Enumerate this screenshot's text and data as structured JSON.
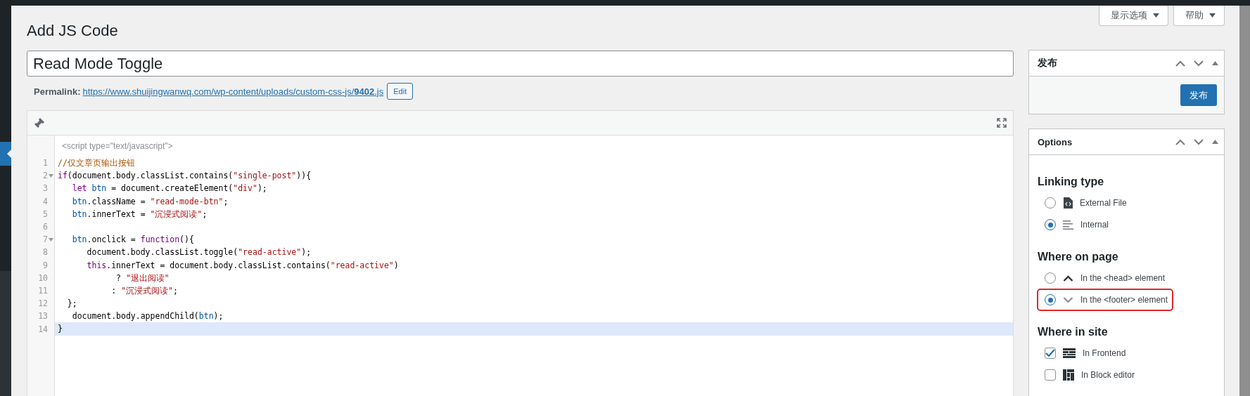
{
  "top_buttons": [
    {
      "label": "显示选项"
    },
    {
      "label": "帮助"
    }
  ],
  "page_title": "Add JS Code",
  "title_field": {
    "value": "Read Mode Toggle"
  },
  "permalink": {
    "label": "Permalink:",
    "url": "https://www.shuijingwanwq.com/wp-content/uploads/custom-css-js/**9402**.js",
    "edit_button": "Edit"
  },
  "editor": {
    "header_line": "<script type=\"text/javascript\">",
    "lines": [
      {
        "number": "1",
        "foldable": false,
        "active": false,
        "tokens": [
          {
            "kind": "comment",
            "text": "//仅文章页输出按钮"
          }
        ]
      },
      {
        "number": "2",
        "foldable": true,
        "active": false,
        "tokens": [
          {
            "kind": "keyword",
            "text": "if"
          },
          {
            "kind": "plain",
            "text": "(document.body.classList.contains("
          },
          {
            "kind": "string",
            "text": "\"single-post\""
          },
          {
            "kind": "plain",
            "text": ")){"
          }
        ]
      },
      {
        "number": "3",
        "foldable": false,
        "active": false,
        "tokens": [
          {
            "kind": "keyword",
            "text": "   let"
          },
          {
            "kind": "variable",
            "text": " btn"
          },
          {
            "kind": "plain",
            "text": " = document.createElement("
          },
          {
            "kind": "string",
            "text": "\"div\""
          },
          {
            "kind": "plain",
            "text": ");"
          }
        ]
      },
      {
        "number": "4",
        "foldable": false,
        "active": false,
        "tokens": [
          {
            "kind": "variable",
            "text": "   btn"
          },
          {
            "kind": "plain",
            "text": ".className = "
          },
          {
            "kind": "string",
            "text": "\"read-mode-btn\""
          },
          {
            "kind": "plain",
            "text": ";"
          }
        ]
      },
      {
        "number": "5",
        "foldable": false,
        "active": false,
        "tokens": [
          {
            "kind": "variable",
            "text": "   btn"
          },
          {
            "kind": "plain",
            "text": ".innerText = "
          },
          {
            "kind": "string",
            "text": "\"沉浸式阅读\""
          },
          {
            "kind": "plain",
            "text": ";"
          }
        ]
      },
      {
        "number": "6",
        "foldable": false,
        "active": false
      },
      {
        "number": "7",
        "foldable": true,
        "active": false,
        "tokens": [
          {
            "kind": "variable",
            "text": "   btn"
          },
          {
            "kind": "plain",
            "text": ".onclick = "
          },
          {
            "kind": "keyword",
            "text": "function"
          },
          {
            "kind": "plain",
            "text": "(){"
          }
        ]
      },
      {
        "number": "8",
        "foldable": false,
        "active": false,
        "tokens": [
          {
            "kind": "plain",
            "text": "      document.body.classList.toggle("
          },
          {
            "kind": "string",
            "text": "\"read-active\""
          },
          {
            "kind": "plain",
            "text": ");"
          }
        ]
      },
      {
        "number": "9",
        "foldable": false,
        "active": false,
        "tokens": [
          {
            "kind": "keyword",
            "text": "      this"
          },
          {
            "kind": "plain",
            "text": ".innerText = document.body.classList.contains("
          },
          {
            "kind": "string",
            "text": "\"read-active\""
          },
          {
            "kind": "plain",
            "text": ")"
          }
        ]
      },
      {
        "number": "10",
        "foldable": false,
        "active": false,
        "tokens": [
          {
            "kind": "plain",
            "text": "            ? "
          },
          {
            "kind": "string",
            "text": "\"退出阅读\""
          }
        ]
      },
      {
        "number": "11",
        "foldable": false,
        "active": false,
        "tokens": [
          {
            "kind": "plain",
            "text": "           : "
          },
          {
            "kind": "string",
            "text": "\"沉浸式阅读\""
          },
          {
            "kind": "plain",
            "text": ";"
          }
        ]
      },
      {
        "number": "12",
        "foldable": false,
        "active": false,
        "tokens": [
          {
            "kind": "plain",
            "text": "  };"
          }
        ]
      },
      {
        "number": "13",
        "foldable": false,
        "active": false,
        "tokens": [
          {
            "kind": "plain",
            "text": "   document.body.appendChild("
          },
          {
            "kind": "variable",
            "text": "btn"
          },
          {
            "kind": "plain",
            "text": ");"
          }
        ]
      },
      {
        "number": "14",
        "foldable": false,
        "active": true,
        "tokens": [
          {
            "kind": "plain",
            "text": "}"
          }
        ]
      }
    ]
  },
  "sidebar": {
    "publish_box": {
      "title": "发布",
      "button": "发布"
    },
    "options_box": {
      "title": "Options",
      "sections": [
        {
          "heading": "Linking type",
          "items": [
            {
              "kind": "radio",
              "label": "External File",
              "selected": false,
              "highlighted": false
            },
            {
              "kind": "radio",
              "label": "Internal",
              "selected": true,
              "highlighted": false
            }
          ]
        },
        {
          "heading": "Where on page",
          "items": [
            {
              "kind": "radio",
              "label": "In the <head> element",
              "selected": false,
              "highlighted": false
            },
            {
              "kind": "radio",
              "label": "In the <footer> element",
              "selected": true,
              "highlighted": true
            }
          ]
        },
        {
          "heading": "Where in site",
          "items": [
            {
              "kind": "checkbox",
              "label": "In Frontend",
              "checked": true,
              "highlighted": false
            },
            {
              "kind": "checkbox",
              "label": "In Block editor",
              "checked": false,
              "highlighted": false
            }
          ]
        }
      ]
    }
  }
}
